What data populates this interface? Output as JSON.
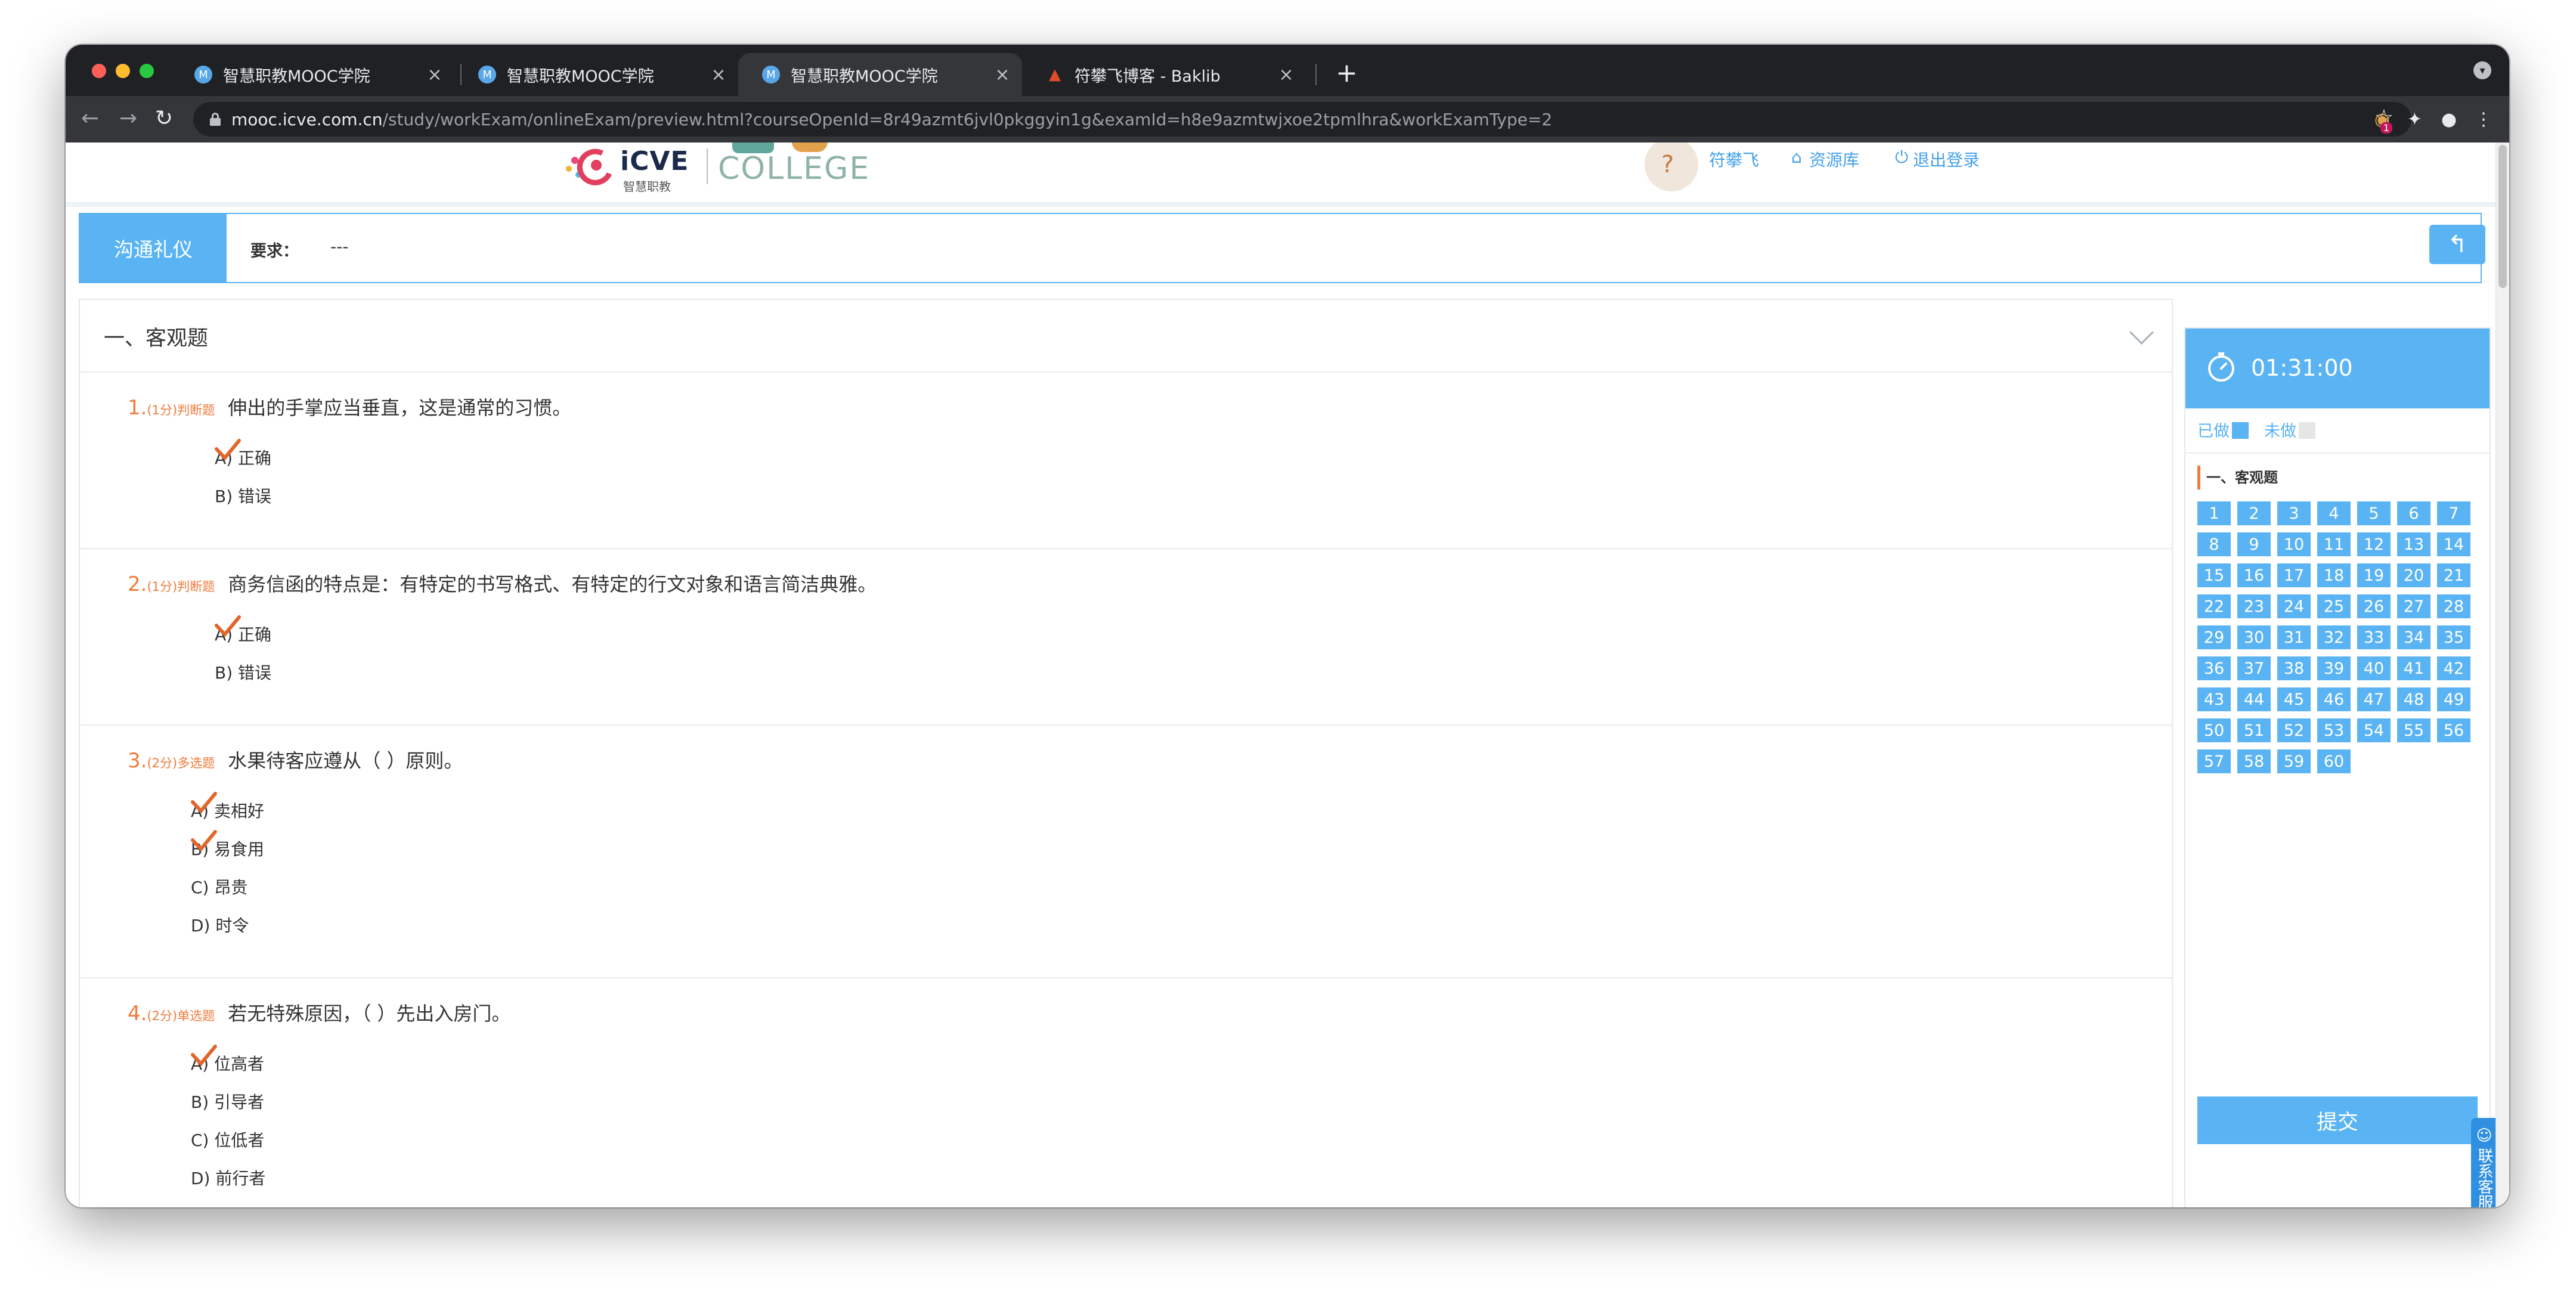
{
  "browser": {
    "tabs": [
      {
        "title": "智慧职教MOOC学院",
        "icon": "mooc-favicon",
        "active": false
      },
      {
        "title": "智慧职教MOOC学院",
        "icon": "mooc-favicon",
        "active": false
      },
      {
        "title": "智慧职教MOOC学院",
        "icon": "mooc-favicon",
        "active": true
      },
      {
        "title": "符攀飞博客 - Baklib",
        "icon": "baklib-favicon",
        "active": false
      }
    ],
    "favicon_letter": "M",
    "url_host": "mooc.icve.com.cn",
    "url_path": "/study/workExam/onlineExam/preview.html?courseOpenId=8r49azmt6jvl0pkggyin1g&examId=h8e9azmtwjxoe2tpmlhra&workExamType=2",
    "extension_badge": "1"
  },
  "header": {
    "logo_icve": "iCVE",
    "logo_cn": "智慧职教",
    "logo_college": "COLLEGE",
    "user_name": "符攀飞",
    "resource_link": "资源库",
    "logout_link": "退出登录"
  },
  "exam": {
    "title": "沟通礼仪",
    "requirement_label": "要求：",
    "requirement_value": "---"
  },
  "section": {
    "title": "一、客观题"
  },
  "questions": [
    {
      "num": "1.",
      "meta": "(1分)判断题",
      "text": "伸出的手掌应当垂直，这是通常的习惯。",
      "options": [
        "A) 正确",
        "B) 错误"
      ],
      "selected": [
        0
      ]
    },
    {
      "num": "2.",
      "meta": "(1分)判断题",
      "text": "商务信函的特点是：有特定的书写格式、有特定的行文对象和语言简洁典雅。",
      "options": [
        "A) 正确",
        "B) 错误"
      ],
      "selected": [
        0
      ]
    },
    {
      "num": "3.",
      "meta": "(2分)多选题",
      "text": "水果待客应遵从（   ）原则。",
      "options": [
        "A) 卖相好",
        "B) 易食用",
        "C) 昂贵",
        "D) 时令"
      ],
      "selected": [
        0,
        1
      ]
    },
    {
      "num": "4.",
      "meta": "(2分)单选题",
      "text": "若无特殊原因，（   ）先出入房门。",
      "options": [
        "A) 位高者",
        "B) 引导者",
        "C) 位低者",
        "D) 前行者"
      ],
      "selected": [
        0
      ]
    }
  ],
  "answer_card": {
    "timer": "01:31:00",
    "legend_done": "已做",
    "legend_undone": "未做",
    "section_label": "一、客观题",
    "numbers": [
      "1",
      "2",
      "3",
      "4",
      "5",
      "6",
      "7",
      "8",
      "9",
      "10",
      "11",
      "12",
      "13",
      "14",
      "15",
      "16",
      "17",
      "18",
      "19",
      "20",
      "21",
      "22",
      "23",
      "24",
      "25",
      "26",
      "27",
      "28",
      "29",
      "30",
      "31",
      "32",
      "33",
      "34",
      "35",
      "36",
      "37",
      "38",
      "39",
      "40",
      "41",
      "42",
      "43",
      "44",
      "45",
      "46",
      "47",
      "48",
      "49",
      "50",
      "51",
      "52",
      "53",
      "54",
      "55",
      "56",
      "57",
      "58",
      "59",
      "60"
    ],
    "submit_label": "提交"
  },
  "service": {
    "label": "联系客服"
  },
  "colors": {
    "accent": "#5ab4f3",
    "question_accent": "#f07c3c",
    "check": "#e0662c",
    "undone": "#e6e6e6"
  }
}
